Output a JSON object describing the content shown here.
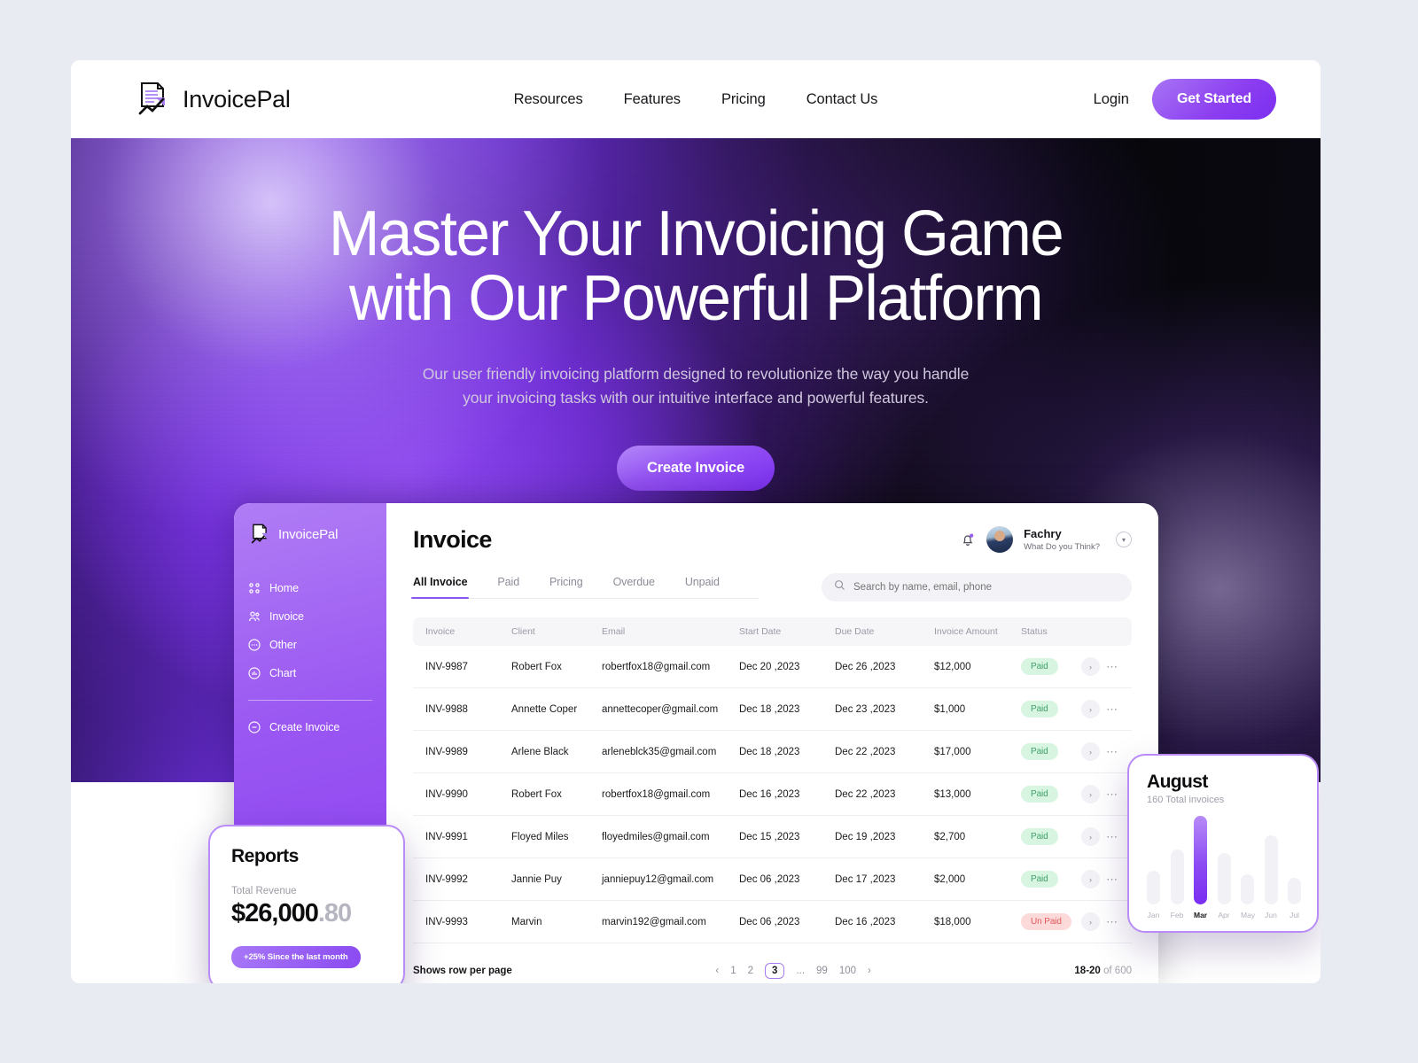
{
  "brand": {
    "name": "InvoicePal",
    "logo_icon": "invoice-chart-logo"
  },
  "navbar": {
    "links": [
      {
        "label": "Resources"
      },
      {
        "label": "Features"
      },
      {
        "label": "Pricing"
      },
      {
        "label": "Contact Us"
      }
    ],
    "login_label": "Login",
    "cta_label": "Get Started",
    "cta_color": "#8b3df0"
  },
  "hero": {
    "title_line1": "Master Your Invoicing Game",
    "title_line2": "with Our Powerful Platform",
    "sub_line1": "Our user friendly invoicing platform designed to revolutionize the way you handle",
    "sub_line2": "your invoicing tasks with our intuitive interface and powerful features.",
    "cta_label": "Create Invoice",
    "bg_dark": "#09080c",
    "bg_purple": "#7c2ff0"
  },
  "dashboard": {
    "sidebar": {
      "brand": "InvoicePal",
      "items": [
        {
          "label": "Home",
          "icon": "grid-icon"
        },
        {
          "label": "Invoice",
          "icon": "users-icon"
        },
        {
          "label": "Other",
          "icon": "dots-circle-icon"
        },
        {
          "label": "Chart",
          "icon": "chart-circle-icon"
        }
      ],
      "footer_items": [
        {
          "label": "Create Invoice",
          "icon": "plus-circle-icon"
        }
      ]
    },
    "header": {
      "title": "Invoice",
      "user_name": "Fachry",
      "user_sub": "What Do you Think?",
      "bell_icon": "bell-icon",
      "chevron_icon": "chevron-down-icon"
    },
    "tabs": [
      {
        "label": "All Invoice",
        "active": true
      },
      {
        "label": "Paid",
        "active": false
      },
      {
        "label": "Pricing",
        "active": false
      },
      {
        "label": "Overdue",
        "active": false
      },
      {
        "label": "Unpaid",
        "active": false
      }
    ],
    "search": {
      "placeholder": "Search by name, email, phone",
      "value": "",
      "icon": "search-icon"
    },
    "table": {
      "columns": [
        "Invoice",
        "Client",
        "Email",
        "Start Date",
        "Due Date",
        "Invoice Amount",
        "Status"
      ],
      "rows": [
        {
          "invoice": "INV-9987",
          "client": "Robert Fox",
          "email": "robertfox18@gmail.com",
          "start": "Dec 20 ,2023",
          "due": "Dec 26 ,2023",
          "amount": "$12,000",
          "status": "Paid"
        },
        {
          "invoice": "INV-9988",
          "client": "Annette Coper",
          "email": "annettecoper@gmail.com",
          "start": "Dec 18 ,2023",
          "due": "Dec 23 ,2023",
          "amount": "$1,000",
          "status": "Paid"
        },
        {
          "invoice": "INV-9989",
          "client": "Arlene Black",
          "email": "arleneblck35@gmail.com",
          "start": "Dec 18 ,2023",
          "due": "Dec 22 ,2023",
          "amount": "$17,000",
          "status": "Paid"
        },
        {
          "invoice": "INV-9990",
          "client": "Robert Fox",
          "email": "robertfox18@gmail.com",
          "start": "Dec 16 ,2023",
          "due": "Dec 22 ,2023",
          "amount": "$13,000",
          "status": "Paid"
        },
        {
          "invoice": "INV-9991",
          "client": "Floyed Miles",
          "email": "floyedmiles@gmail.com",
          "start": "Dec 15 ,2023",
          "due": "Dec 19 ,2023",
          "amount": "$2,700",
          "status": "Paid"
        },
        {
          "invoice": "INV-9992",
          "client": "Jannie Puy",
          "email": "janniepuy12@gmail.com",
          "start": "Dec 06 ,2023",
          "due": "Dec 17 ,2023",
          "amount": "$2,000",
          "status": "Paid"
        },
        {
          "invoice": "INV-9993",
          "client": "Marvin",
          "email": "marvin192@gmail.com",
          "start": "Dec 06 ,2023",
          "due": "Dec 16 ,2023",
          "amount": "$18,000",
          "status": "Un Paid"
        }
      ]
    },
    "pagination": {
      "rows_label": "Shows row per page",
      "prev": "‹",
      "next": "›",
      "pages": [
        "1",
        "2",
        "3",
        "...",
        "99",
        "100"
      ],
      "current": "3",
      "range_bold": "18-20",
      "range_rest": " of 600"
    }
  },
  "reports_card": {
    "title": "Reports",
    "label": "Total Revenue",
    "amount_main": "$26,000",
    "amount_dec": ".80",
    "pill": "+25% Since the last month"
  },
  "chart_data": {
    "type": "bar",
    "title": "August",
    "subtitle": "160 Total invoices",
    "categories": [
      "Jan",
      "Feb",
      "Mar",
      "Apr",
      "May",
      "Jun",
      "Jul"
    ],
    "values": [
      38,
      62,
      100,
      58,
      34,
      78,
      30
    ],
    "highlight_index": 2,
    "highlight_color": "#7a2ef2",
    "base_color": "#f2f2f6",
    "xlabel": "",
    "ylabel": "",
    "ylim": [
      0,
      100
    ],
    "grid": false,
    "legend": "none"
  }
}
